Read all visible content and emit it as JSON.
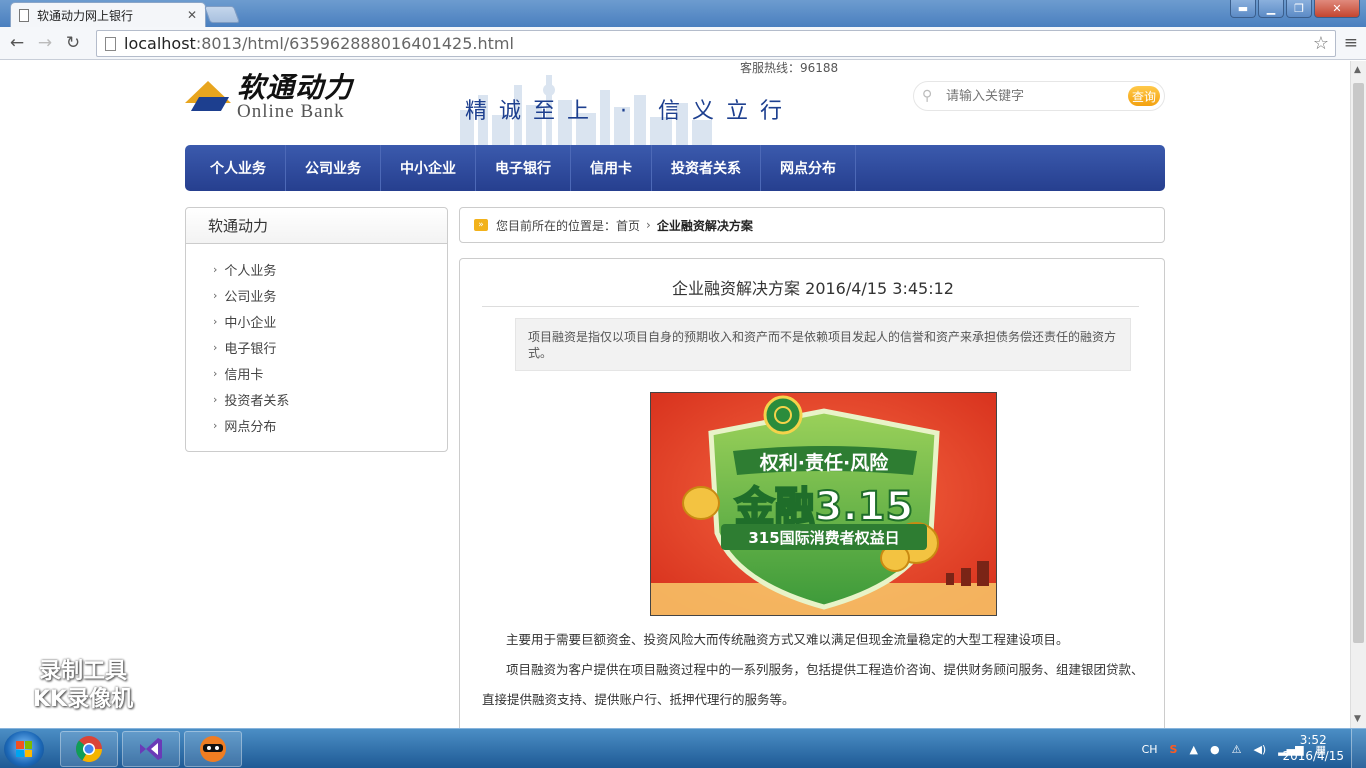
{
  "browser": {
    "tab_title": "软通动力网上银行",
    "url_host": "localhost",
    "url_rest": ":8013/html/635962888016401425.html"
  },
  "header": {
    "logo_cn": "软通动力",
    "logo_en": "Online Bank",
    "hotline": "客服热线：96188",
    "slogan": "精诚至上 · 信义立行",
    "search_placeholder": "请输入关键字",
    "search_button": "查询"
  },
  "nav": [
    "个人业务",
    "公司业务",
    "中小企业",
    "电子银行",
    "信用卡",
    "投资者关系",
    "网点分布"
  ],
  "sidebar": {
    "title": "软通动力",
    "items": [
      "个人业务",
      "公司业务",
      "中小企业",
      "电子银行",
      "信用卡",
      "投资者关系",
      "网点分布"
    ]
  },
  "breadcrumb": {
    "prefix": "您目前所在的位置是：",
    "home": "首页",
    "current": "企业融资解决方案"
  },
  "article": {
    "title": "企业融资解决方案 2016/4/15 3:45:12",
    "summary": "项目融资是指仅以项目自身的预期收入和资产而不是依赖项目发起人的信誉和资产来承担债务偿还责任的融资方式。",
    "image": {
      "line1": "权利·责任·风险",
      "line2": "金融3.15",
      "line3": "315国际消费者权益日"
    },
    "para1": "主要用于需要巨额资金、投资风险大而传统融资方式又难以满足但现金流量稳定的大型工程建设项目。",
    "para2": "项目融资为客户提供在项目融资过程中的一系列服务，包括提供工程造价咨询、提供财务顾问服务、组建银团贷款、直接提供融资支持、提供账户行、抵押代理行的服务等。"
  },
  "watermark": {
    "line1": "录制工具",
    "line2": "KK录像机"
  },
  "taskbar": {
    "lang": "CH",
    "time": "3:52",
    "date": "2016/4/15"
  },
  "colors": {
    "nav_blue": "#263f8f",
    "accent_orange": "#f3a10f",
    "poster_red": "#ec4a2d"
  }
}
